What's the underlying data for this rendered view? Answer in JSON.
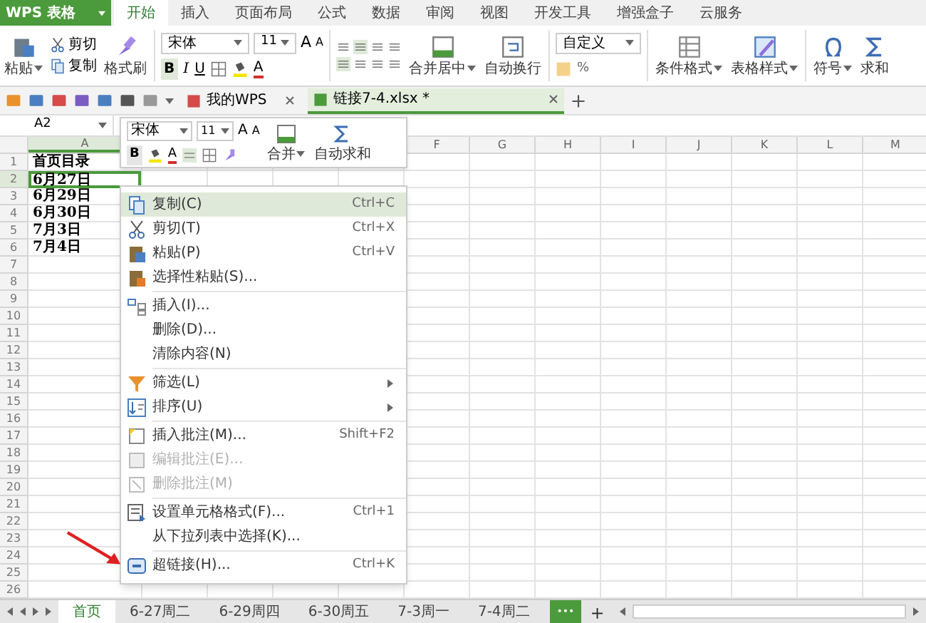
{
  "app": {
    "logo": "WPS 表格"
  },
  "ribbon_tabs": [
    {
      "label": "开始",
      "selected": true
    },
    {
      "label": "插入",
      "selected": false
    },
    {
      "label": "页面布局",
      "selected": false
    },
    {
      "label": "公式",
      "selected": false
    },
    {
      "label": "数据",
      "selected": false
    },
    {
      "label": "审阅",
      "selected": false
    },
    {
      "label": "视图",
      "selected": false
    },
    {
      "label": "开发工具",
      "selected": false
    },
    {
      "label": "增强盒子",
      "selected": false
    },
    {
      "label": "云服务",
      "selected": false
    }
  ],
  "ribbon": {
    "paste": "粘贴",
    "cut": "剪切",
    "copy": "复制",
    "format_painter": "格式刷",
    "font": "宋体",
    "size": "11",
    "bold": "B",
    "italic": "I",
    "underline": "U",
    "grow": "A",
    "shrink": "A",
    "font_color": "A",
    "merge": "合并居中",
    "wrap": "自动换行",
    "number_format": "自定义",
    "percent": "%",
    "conditional": "条件格式",
    "table_style": "表格样式",
    "symbol": "符号",
    "sum": "求和"
  },
  "doc_tabs": [
    {
      "label": "我的WPS",
      "selected": false
    },
    {
      "label": "链接7-4.xlsx *",
      "selected": true
    }
  ],
  "name_box": "A2",
  "columns": [
    "A",
    "F",
    "G",
    "H",
    "I",
    "J",
    "K",
    "L",
    "M"
  ],
  "rows": [
    "1",
    "2",
    "3",
    "4",
    "5",
    "6",
    "7",
    "8",
    "9",
    "10",
    "11",
    "12",
    "13",
    "14",
    "15",
    "16",
    "17",
    "18",
    "19",
    "20",
    "21",
    "22",
    "23",
    "24",
    "25",
    "26"
  ],
  "column_a": [
    {
      "text": "首页目录",
      "selected": false
    },
    {
      "text": "6月27日",
      "selected": true
    },
    {
      "text": "6月29日",
      "selected": false
    },
    {
      "text": "6月30日",
      "selected": false
    },
    {
      "text": "7月3日",
      "selected": false
    },
    {
      "text": "7月4日",
      "selected": false
    }
  ],
  "mini_toolbar": {
    "font": "宋体",
    "size": "11",
    "grow": "A",
    "shrink": "A",
    "bold": "B",
    "font_color": "A",
    "merge": "合并",
    "autosum": "自动求和"
  },
  "context_menu": [
    {
      "kind": "item",
      "label": "复制(C)",
      "shortcut": "Ctrl+C",
      "highlighted": true,
      "disabled": false
    },
    {
      "kind": "item",
      "label": "剪切(T)",
      "shortcut": "Ctrl+X",
      "highlighted": false,
      "disabled": false
    },
    {
      "kind": "item",
      "label": "粘贴(P)",
      "shortcut": "Ctrl+V",
      "highlighted": false,
      "disabled": false
    },
    {
      "kind": "item",
      "label": "选择性粘贴(S)...",
      "highlighted": false,
      "disabled": false
    },
    {
      "kind": "separator"
    },
    {
      "kind": "item",
      "label": "插入(I)...",
      "highlighted": false,
      "disabled": false
    },
    {
      "kind": "item",
      "label": "删除(D)...",
      "highlighted": false,
      "disabled": false
    },
    {
      "kind": "item",
      "label": "清除内容(N)",
      "highlighted": false,
      "disabled": false
    },
    {
      "kind": "separator"
    },
    {
      "kind": "submenu",
      "label": "筛选(L)",
      "highlighted": false,
      "disabled": false
    },
    {
      "kind": "submenu",
      "label": "排序(U)",
      "highlighted": false,
      "disabled": false
    },
    {
      "kind": "separator"
    },
    {
      "kind": "item",
      "label": "插入批注(M)...",
      "shortcut": "Shift+F2",
      "highlighted": false,
      "disabled": false
    },
    {
      "kind": "item",
      "label": "编辑批注(E)...",
      "highlighted": false,
      "disabled": true
    },
    {
      "kind": "item",
      "label": "删除批注(M)",
      "highlighted": false,
      "disabled": true
    },
    {
      "kind": "separator"
    },
    {
      "kind": "item",
      "label": "设置单元格格式(F)...",
      "shortcut": "Ctrl+1",
      "highlighted": false,
      "disabled": false
    },
    {
      "kind": "item",
      "label": "从下拉列表中选择(K)...",
      "highlighted": false,
      "disabled": false
    },
    {
      "kind": "separator"
    },
    {
      "kind": "item",
      "label": "超链接(H)...",
      "shortcut": "Ctrl+K",
      "highlighted": false,
      "disabled": false
    }
  ],
  "sheet_tabs": [
    {
      "label": "首页",
      "selected": true
    },
    {
      "label": "6-27周二",
      "selected": false
    },
    {
      "label": "6-29周四",
      "selected": false
    },
    {
      "label": "6-30周五",
      "selected": false
    },
    {
      "label": "7-3周一",
      "selected": false
    },
    {
      "label": "7-4周二",
      "selected": false
    }
  ],
  "sheet_more": "•••",
  "sheet_add": "+"
}
